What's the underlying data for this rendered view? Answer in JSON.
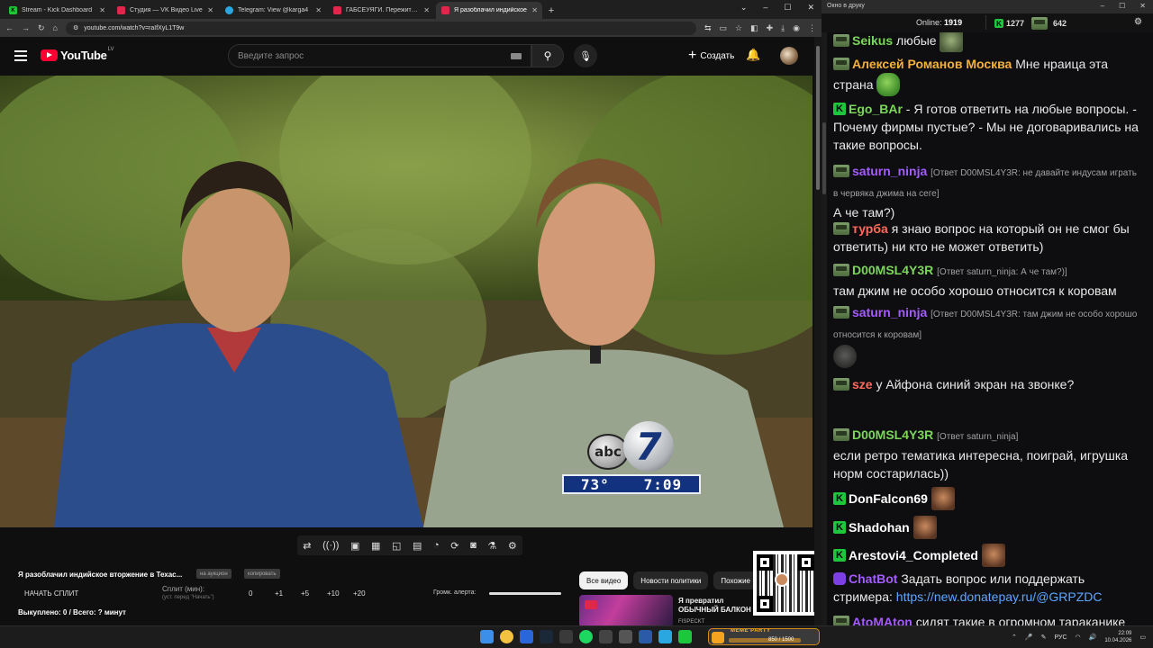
{
  "browser": {
    "tabs": [
      {
        "label": "Stream - Kick Dashboard",
        "favicon_color": "#1ec63d",
        "favicon_glyph": "K",
        "active": false
      },
      {
        "label": "Студия — VK Видео Live",
        "favicon_color": "#e0264a",
        "favicon_glyph": "",
        "active": false
      },
      {
        "label": "Telegram: View @karga4",
        "favicon_color": "#2aa7e0",
        "favicon_glyph": "",
        "active": false
      },
      {
        "label": "ГАБСЕУЯГИ. Пережить индус",
        "favicon_color": "#e0264a",
        "favicon_glyph": "",
        "active": false
      },
      {
        "label": "Я разоблачил индийское",
        "favicon_color": "#e0264a",
        "favicon_glyph": "",
        "active": true
      }
    ],
    "url": "youtube.com/watch?v=raIfXyL1T9w"
  },
  "youtube": {
    "logo_text": "YouTube",
    "country_code": "LV",
    "search_placeholder": "Введите запрос",
    "create_label": "Создать"
  },
  "video": {
    "abc_text": "abc",
    "channel_number": "7",
    "temperature": "73°",
    "time": "7:09"
  },
  "panel": {
    "video_title": "Я разоблачил индийское вторжение в Техас...",
    "chip_auction": "на аукцион",
    "chip_copy": "копировать",
    "split_button": "НАЧАТЬ СПЛИТ",
    "split_label": "Сплит (мин):",
    "split_sub": "(уст. перед \"Начать\")",
    "split_values": [
      "0",
      "+1",
      "+5",
      "+10",
      "+20"
    ],
    "alert_label": "Громк. алерта:",
    "alert_volume": 1.0,
    "bought": "Выкуплено: 0 / Всего: ? минут"
  },
  "recommendations": {
    "chips": [
      "Все видео",
      "Новости политики",
      "Похожие"
    ],
    "video_title": "Я превратил ОБЫЧНЫЙ БАЛКОН В ГЕЙМЕРСКИЙ",
    "channel": "FISPECKT"
  },
  "chat_window": {
    "title": "Окно в друку",
    "online_label": "Online:",
    "online_count": "1919",
    "kick_count": "1277",
    "vk_count": "642"
  },
  "chat_messages": [
    {
      "user": "Seikus",
      "color": "#7bd65a",
      "badge": "sub",
      "reply": "",
      "text": "любые",
      "emote": "hand"
    },
    {
      "user": "Алексей Романов Москва",
      "color": "#f4b03e",
      "badge": "sub",
      "reply": "",
      "text": "Мне нраица эта страна",
      "emote": "frog"
    },
    {
      "user": "Ego_BAr",
      "color": "#7bd65a",
      "badge": "kick",
      "reply": "",
      "text": "- Я готов ответить на любые вопросы. - Почему фирмы пустые? - Мы не договаривались на такие вопросы.",
      "emote": ""
    },
    {
      "user": "saturn_ninja",
      "color": "#a45bff",
      "badge": "sub",
      "reply": "[Ответ D00MSL4Y3R: не давайте индусам играть в червяка джима на сеге]",
      "text": "А че там?)",
      "emote": ""
    },
    {
      "user": "турба",
      "color": "#ff6a5a",
      "badge": "sub",
      "reply": "",
      "text": "я знаю вопрос на который он не смог бы ответить) ни кто не может ответить)",
      "emote": ""
    },
    {
      "user": "D00MSL4Y3R",
      "color": "#7bd65a",
      "badge": "sub",
      "reply": "[Ответ saturn_ninja: А че там?)]",
      "text": "там джим не особо хорошо относится к коровам",
      "emote": ""
    },
    {
      "user": "saturn_ninja",
      "color": "#a45bff",
      "badge": "sub",
      "reply": "[Ответ D00MSL4Y3R: там джим не особо хорошо относится к коровам]",
      "text": "",
      "emote": "cat"
    },
    {
      "user": "sze",
      "color": "#ff6a5a",
      "badge": "sub",
      "reply": "",
      "text": "у Айфона синий экран на звонке?",
      "emote": ""
    },
    {
      "user": "D00MSL4Y3R",
      "color": "#7bd65a",
      "badge": "sub",
      "reply": "[Ответ saturn_ninja]",
      "text": "если ретро тематика интересна, поиграй, игрушка норм состарилась))",
      "emote": ""
    },
    {
      "user": "DonFalcon69",
      "color": "#ffffff",
      "badge": "kick",
      "reply": "",
      "text": "",
      "emote": "face"
    },
    {
      "user": "Shadohan",
      "color": "#ffffff",
      "badge": "kick",
      "reply": "",
      "text": "",
      "emote": "face"
    },
    {
      "user": "Arestovi4_Completed",
      "color": "#ffffff",
      "badge": "kick",
      "reply": "",
      "text": "",
      "emote": "face"
    },
    {
      "user": "ChatBot",
      "color": "#a45bff",
      "badge": "bot",
      "reply": "",
      "text": "Задать вопрос или поддержать стримера:",
      "link": "https://new.donatepay.ru/@GRPZDC",
      "emote": ""
    },
    {
      "user": "AtoMAton",
      "color": "#a45bff",
      "badge": "sub",
      "reply": "",
      "text": "сидят такие в огромном тараканике",
      "emote": ""
    }
  ],
  "taskbar": {
    "meme_title": "MEME PARTY",
    "meme_count": "850 / 1500",
    "lang": "РУС",
    "time": "22:09",
    "date": "10.04.2026"
  }
}
